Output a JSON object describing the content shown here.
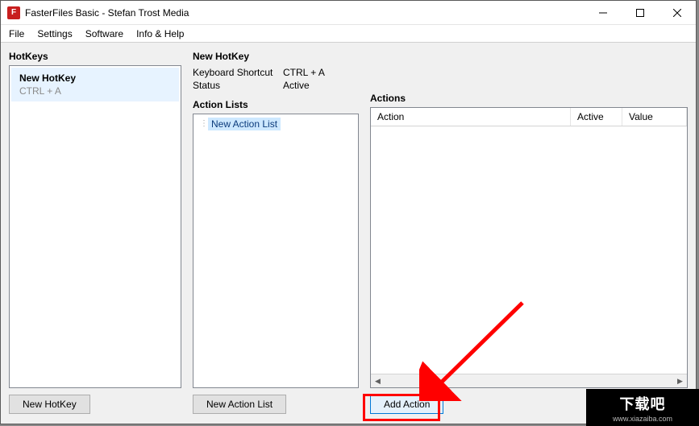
{
  "window": {
    "title": "FasterFiles Basic - Stefan Trost Media",
    "appicon_letter": "F"
  },
  "menu": {
    "items": [
      "File",
      "Settings",
      "Software",
      "Info & Help"
    ]
  },
  "left": {
    "title": "HotKeys",
    "items": [
      {
        "name": "New HotKey",
        "shortcut": "CTRL + A"
      }
    ],
    "new_button": "New HotKey"
  },
  "details": {
    "title": "New HotKey",
    "rows": [
      {
        "label": "Keyboard Shortcut",
        "value": "CTRL + A"
      },
      {
        "label": "Status",
        "value": "Active"
      }
    ]
  },
  "action_lists": {
    "title": "Action Lists",
    "items": [
      {
        "label": "New Action List"
      }
    ],
    "new_button": "New Action List"
  },
  "actions": {
    "title": "Actions",
    "columns": {
      "action": "Action",
      "active": "Active",
      "value": "Value"
    },
    "rows": [],
    "add_button": "Add Action"
  },
  "watermark": {
    "large": "下载吧",
    "small": "www.xiazaiba.com"
  }
}
